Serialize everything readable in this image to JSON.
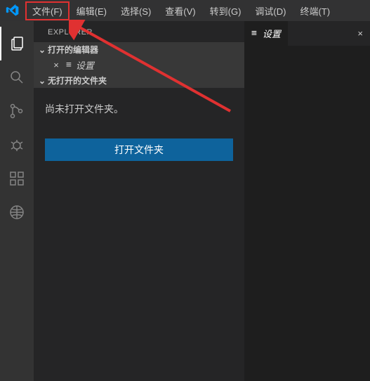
{
  "menu": {
    "file": "文件(F)",
    "edit": "编辑(E)",
    "select": "选择(S)",
    "view": "查看(V)",
    "goto": "转到(G)",
    "debug": "调试(D)",
    "terminal": "终端(T)"
  },
  "sidebar": {
    "title": "EXPLORER",
    "sections": {
      "open_editors": "打开的编辑器",
      "no_folder": "无打开的文件夹"
    },
    "open_item": {
      "close": "×",
      "icon": "≡",
      "label": "设置"
    },
    "message": "尚未打开文件夹。",
    "open_button": "打开文件夹"
  },
  "editor": {
    "tab": {
      "icon": "≡",
      "label": "设置",
      "close": "×"
    }
  }
}
